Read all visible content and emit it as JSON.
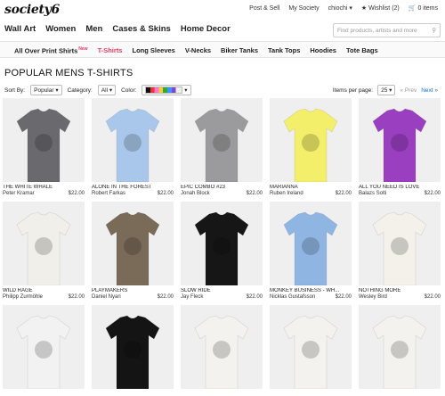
{
  "brand": {
    "logo": "society6"
  },
  "topbar": {
    "post_sell": "Post & Sell",
    "my_society": "My Society",
    "user": "chiochi",
    "wishlist": "Wishlist (2)",
    "cart": "0 items"
  },
  "mainnav": [
    "Wall Art",
    "Women",
    "Men",
    "Cases & Skins",
    "Home Decor"
  ],
  "search": {
    "placeholder": "Find products, artists and more"
  },
  "subnav": {
    "items": [
      "All Over Print Shirts",
      "T-Shirts",
      "Long Sleeves",
      "V-Necks",
      "Biker Tanks",
      "Tank Tops",
      "Hoodies",
      "Tote Bags"
    ],
    "new_badge": "New",
    "active": "T-Shirts"
  },
  "page": {
    "title": "POPULAR MENS T-SHIRTS"
  },
  "filters": {
    "sort_label": "Sort By:",
    "sort_value": "Popular",
    "category_label": "Category:",
    "category_value": "All",
    "color_label": "Color:"
  },
  "pager": {
    "per_page_label": "Items per page:",
    "per_page_value": "25",
    "prev": "« Prev",
    "next": "Next »"
  },
  "products": [
    {
      "title": "THE WHITE WHALE",
      "artist": "Peter Kramar",
      "price": "$22.00",
      "shirt_color": "#6a6a6e"
    },
    {
      "title": "ALONE IN THE FOREST",
      "artist": "Robert Farkas",
      "price": "$22.00",
      "shirt_color": "#a9c7ea"
    },
    {
      "title": "EPIC COMBO #23",
      "artist": "Jonah Block",
      "price": "$22.00",
      "shirt_color": "#9b9b9d"
    },
    {
      "title": "MARIANNA",
      "artist": "Ruben Ireland",
      "price": "$22.00",
      "shirt_color": "#f4ef6a"
    },
    {
      "title": "ALL YOU NEED IS LOVE",
      "artist": "Balazs Solti",
      "price": "$22.00",
      "shirt_color": "#9b3fc1"
    },
    {
      "title": "WILD RAGE",
      "artist": "Philipp Zurmöhle",
      "price": "$22.00",
      "shirt_color": "#f1efe9"
    },
    {
      "title": "PLAYMAKERS",
      "artist": "Daniel Nyari",
      "price": "$22.00",
      "shirt_color": "#7a6a58"
    },
    {
      "title": "SLOW RIDE",
      "artist": "Jay Fleck",
      "price": "$22.00",
      "shirt_color": "#161616"
    },
    {
      "title": "MONKEY BUSINESS - WH...",
      "artist": "Nicklas Gustafsson",
      "price": "$22.00",
      "shirt_color": "#8fb6e3"
    },
    {
      "title": "NOTHING MORE",
      "artist": "Wesley Bird",
      "price": "$22.00",
      "shirt_color": "#f3f1ea"
    },
    {
      "title": "",
      "artist": "",
      "price": "",
      "shirt_color": "#f2f2f2"
    },
    {
      "title": "",
      "artist": "",
      "price": "",
      "shirt_color": "#141414"
    },
    {
      "title": "",
      "artist": "",
      "price": "",
      "shirt_color": "#f4f2ee"
    },
    {
      "title": "",
      "artist": "",
      "price": "",
      "shirt_color": "#f4f2ee"
    },
    {
      "title": "",
      "artist": "",
      "price": "",
      "shirt_color": "#f4f2ee"
    }
  ]
}
